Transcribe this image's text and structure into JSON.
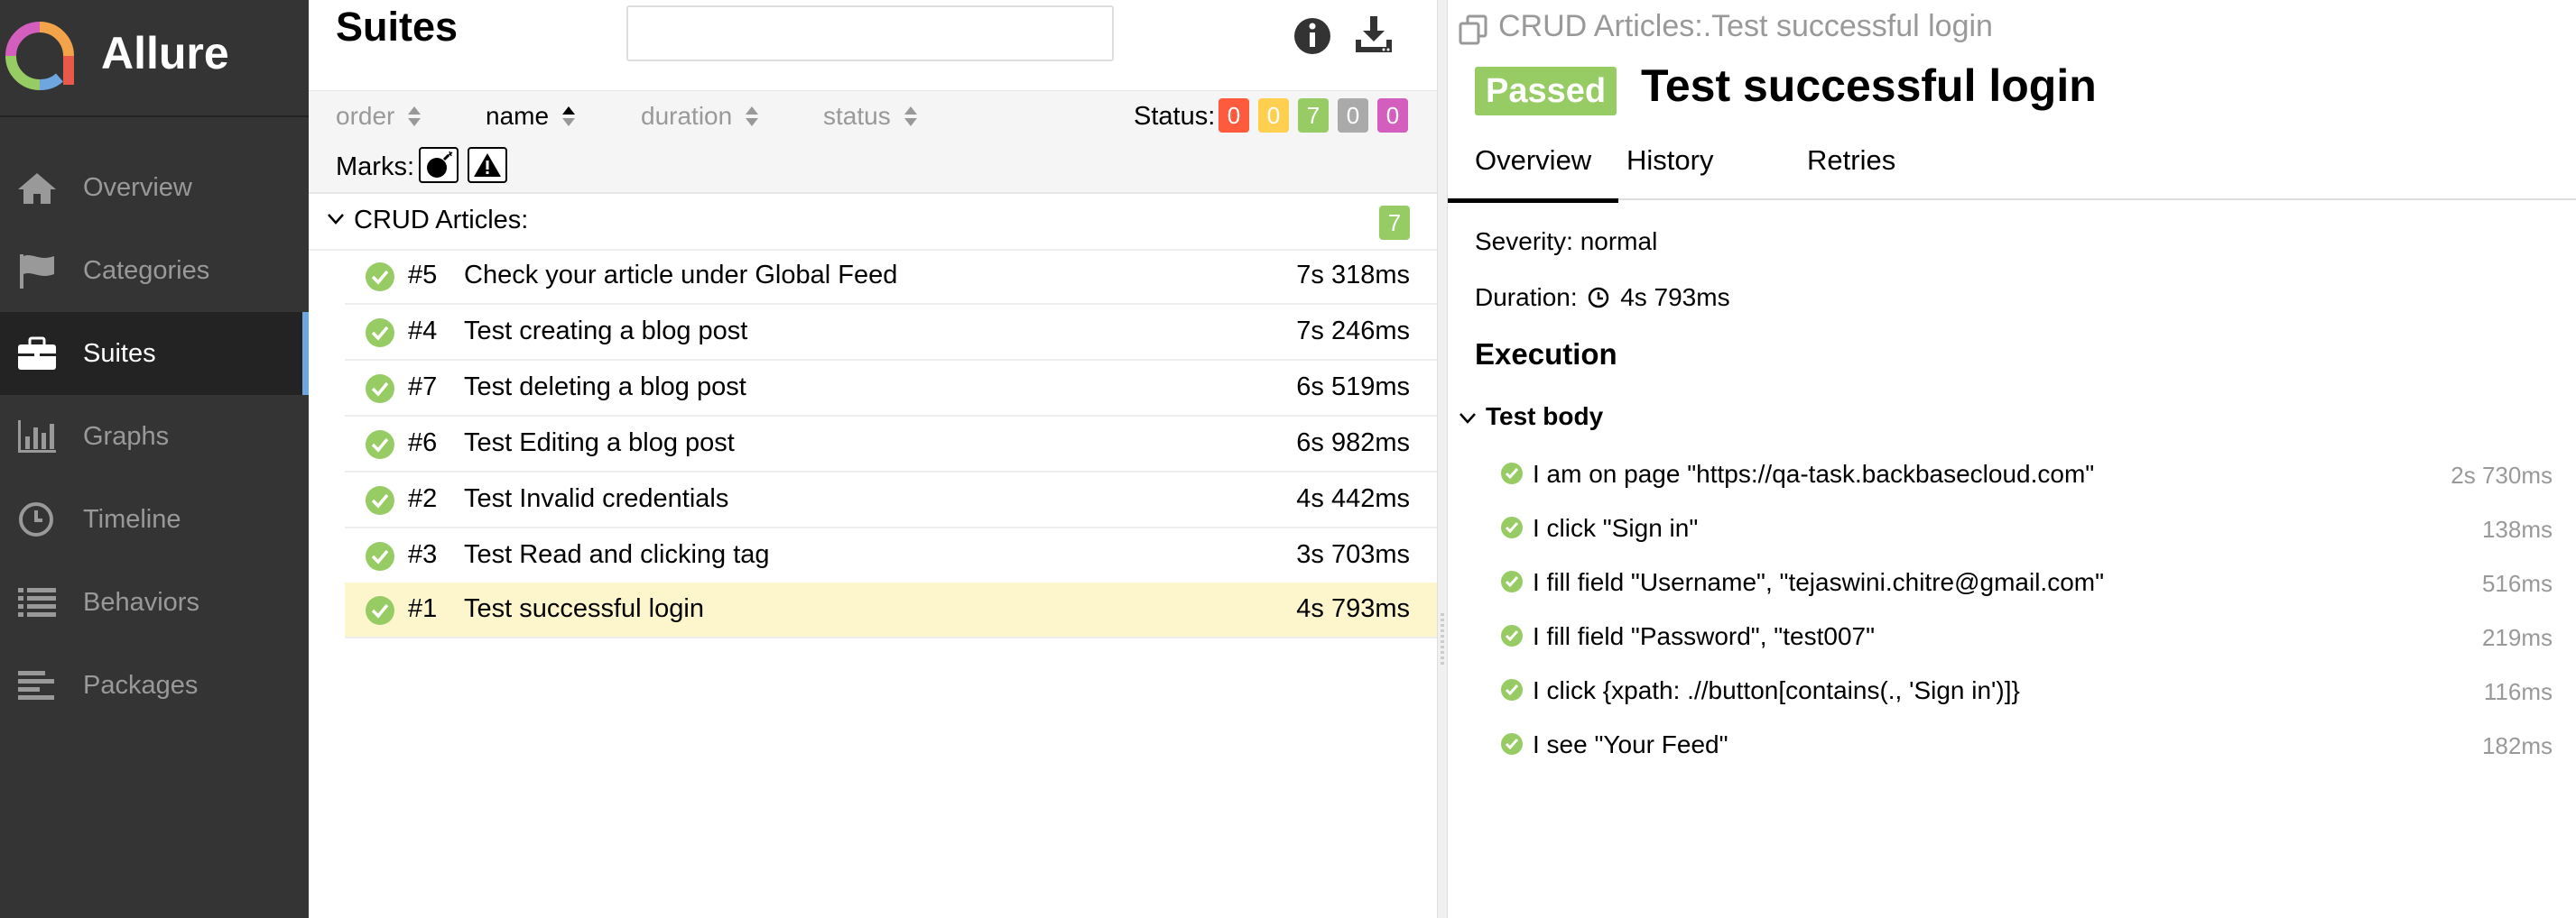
{
  "app": {
    "name": "Allure"
  },
  "nav": [
    {
      "label": "Overview",
      "icon": "home-icon"
    },
    {
      "label": "Categories",
      "icon": "flag-icon"
    },
    {
      "label": "Suites",
      "icon": "briefcase-icon",
      "active": true
    },
    {
      "label": "Graphs",
      "icon": "bar-chart-icon"
    },
    {
      "label": "Timeline",
      "icon": "clock-icon"
    },
    {
      "label": "Behaviors",
      "icon": "list-icon"
    },
    {
      "label": "Packages",
      "icon": "align-left-icon"
    }
  ],
  "suites": {
    "title": "Suites",
    "search_value": "",
    "sort": {
      "order": "order",
      "name": "name",
      "duration": "duration",
      "status": "status",
      "active": "name"
    },
    "status_label": "Status:",
    "status_counts": [
      {
        "status": "failed",
        "count": "0",
        "color": "#fd5a3e"
      },
      {
        "status": "broken",
        "count": "0",
        "color": "#ffd050"
      },
      {
        "status": "passed",
        "count": "7",
        "color": "#97cc64"
      },
      {
        "status": "skipped",
        "count": "0",
        "color": "#aaaaaa"
      },
      {
        "status": "unknown",
        "count": "0",
        "color": "#d35ebe"
      }
    ],
    "marks_label": "Marks:",
    "group": {
      "label": "CRUD Articles:",
      "count": "7"
    },
    "tests": [
      {
        "num": "#5",
        "name": "Check your article under Global Feed",
        "duration": "7s 318ms"
      },
      {
        "num": "#4",
        "name": "Test creating a blog post",
        "duration": "7s 246ms"
      },
      {
        "num": "#7",
        "name": "Test deleting a blog post",
        "duration": "6s 519ms"
      },
      {
        "num": "#6",
        "name": "Test Editing a blog post",
        "duration": "6s 982ms"
      },
      {
        "num": "#2",
        "name": "Test Invalid credentials",
        "duration": "4s 442ms"
      },
      {
        "num": "#3",
        "name": "Test Read and clicking tag",
        "duration": "3s 703ms"
      },
      {
        "num": "#1",
        "name": "Test successful login",
        "duration": "4s 793ms",
        "selected": true
      }
    ]
  },
  "detail": {
    "breadcrumb": "CRUD Articles:.Test successful login",
    "status_badge": "Passed",
    "title": "Test successful login",
    "tabs": [
      "Overview",
      "History",
      "Retries"
    ],
    "severity": "Severity: normal",
    "duration_label": "Duration:",
    "duration": "4s 793ms",
    "execution_title": "Execution",
    "test_body_label": "Test body",
    "steps": [
      {
        "name": "I am on page \"https://qa-task.backbasecloud.com\"",
        "duration": "2s 730ms"
      },
      {
        "name": "I click \"Sign in\"",
        "duration": "138ms"
      },
      {
        "name": "I fill field \"Username\", \"tejaswini.chitre@gmail.com\"",
        "duration": "516ms"
      },
      {
        "name": "I fill field \"Password\", \"test007\"",
        "duration": "219ms"
      },
      {
        "name": "I click {xpath: .//button[contains(., 'Sign in')]}",
        "duration": "116ms"
      },
      {
        "name": "I see \"Your Feed\"",
        "duration": "182ms"
      }
    ]
  },
  "colors": {
    "sidebar": "#343434",
    "accent": "#6ea6e0",
    "passed": "#97cc64",
    "selected_row": "#fdf6cc"
  }
}
